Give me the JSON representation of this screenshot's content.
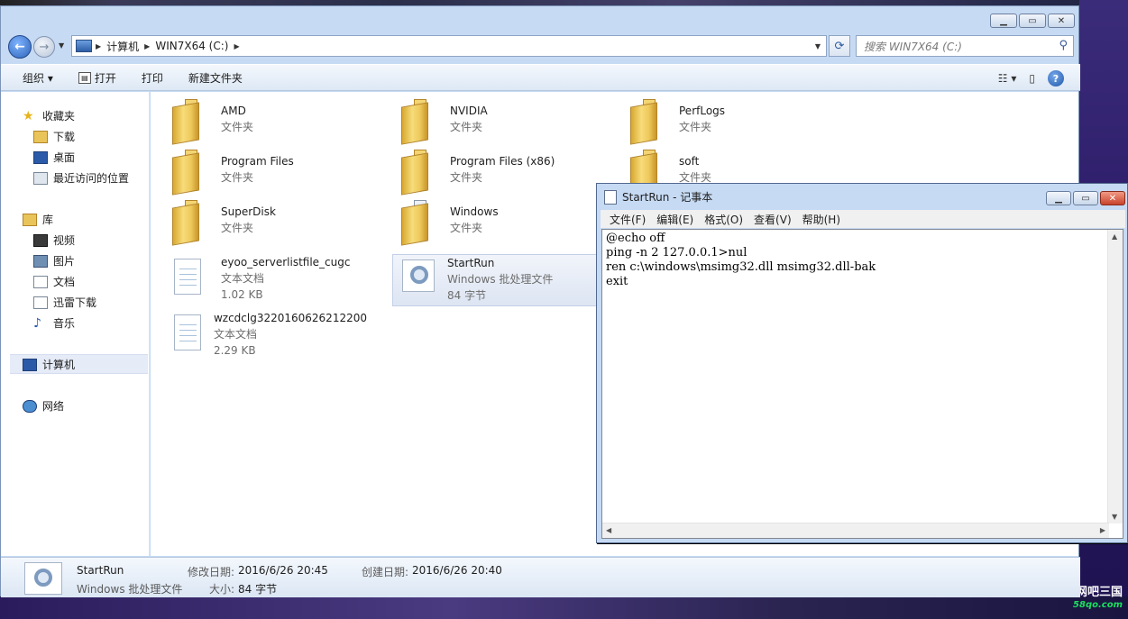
{
  "explorer": {
    "breadcrumb": [
      "计算机",
      "WIN7X64 (C:)"
    ],
    "search_placeholder": "搜索 WIN7X64 (C:)",
    "toolbar": {
      "organize": "组织 ▾",
      "open": "打开",
      "print": "打印",
      "new_folder": "新建文件夹"
    },
    "navpane": {
      "favorites": "收藏夹",
      "downloads": "下载",
      "desktop": "桌面",
      "recent": "最近访问的位置",
      "libraries": "库",
      "videos": "视频",
      "pictures": "图片",
      "documents": "文档",
      "thunder": "迅雷下载",
      "music": "音乐",
      "computer": "计算机",
      "network": "网络"
    },
    "files": [
      {
        "name": "AMD",
        "type": "文件夹",
        "kind": "folder"
      },
      {
        "name": "NVIDIA",
        "type": "文件夹",
        "kind": "folder"
      },
      {
        "name": "PerfLogs",
        "type": "文件夹",
        "kind": "folder"
      },
      {
        "name": "Program Files",
        "type": "文件夹",
        "kind": "folder"
      },
      {
        "name": "Program Files (x86)",
        "type": "文件夹",
        "kind": "folder"
      },
      {
        "name": "soft",
        "type": "文件夹",
        "kind": "folder"
      },
      {
        "name": "SuperDisk",
        "type": "文件夹",
        "kind": "folder"
      },
      {
        "name": "Windows",
        "type": "文件夹",
        "kind": "folder"
      },
      {
        "name": "eyoo_serverlistfile_cugc",
        "type": "文本文档",
        "size": "1.02 KB",
        "kind": "text"
      },
      {
        "name": "StartRun",
        "type": "Windows 批处理文件",
        "size": "84 字节",
        "kind": "batch"
      },
      {
        "name": "wzcdclg3220160626212200",
        "type": "文本文档",
        "size": "2.29 KB",
        "kind": "text"
      }
    ],
    "details": {
      "name": "StartRun",
      "type": "Windows 批处理文件",
      "modified_label": "修改日期:",
      "modified": "2016/6/26 20:45",
      "created_label": "创建日期:",
      "created": "2016/6/26 20:40",
      "size_label": "大小:",
      "size": "84 字节"
    }
  },
  "notepad": {
    "title": "StartRun - 记事本",
    "menus": [
      "文件(F)",
      "编辑(E)",
      "格式(O)",
      "查看(V)",
      "帮助(H)"
    ],
    "content": "@echo off\nping -n 2 127.0.0.1>nul\nren c:\\windows\\msimg32.dll msimg32.dll-bak\nexit"
  },
  "watermark": {
    "line1": "网吧三国",
    "line2": "58qo.com"
  },
  "colors": {
    "window_frame": "#c6daf3",
    "selection": "#e5ebf7",
    "desktop": "#3a1f7a"
  }
}
